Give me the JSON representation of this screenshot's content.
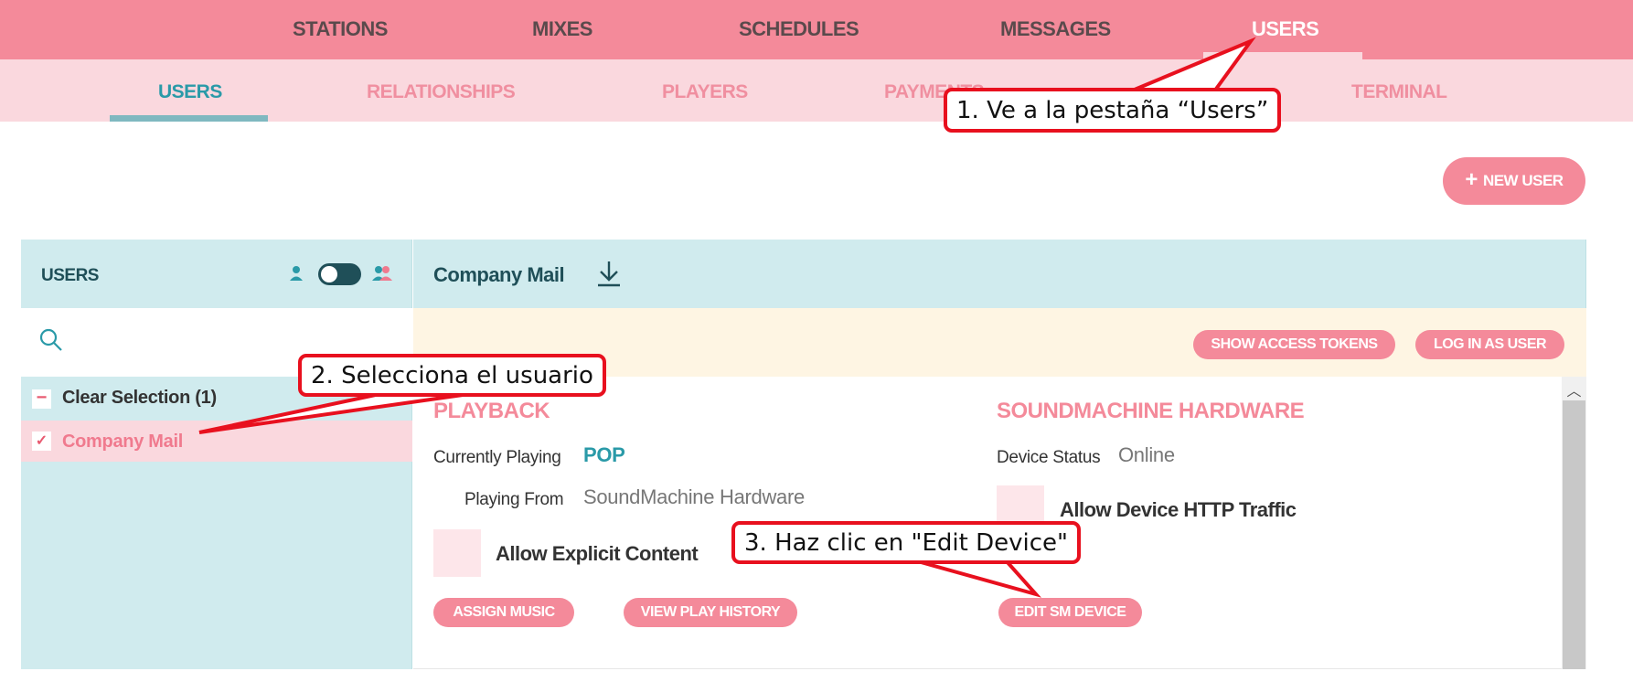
{
  "top_nav": {
    "tabs": [
      "STATIONS",
      "MIXES",
      "SCHEDULES",
      "MESSAGES",
      "USERS"
    ]
  },
  "sub_nav": {
    "tabs": [
      "USERS",
      "RELATIONSHIPS",
      "PLAYERS",
      "PAYMENTS",
      "TERMINAL"
    ]
  },
  "new_user_label": "NEW USER",
  "users_panel": {
    "title": "USERS",
    "search_placeholder": "",
    "clear_selection": "Clear Selection (1)",
    "users": [
      "Company Mail"
    ]
  },
  "detail": {
    "user_name": "Company Mail",
    "actions": {
      "show_tokens": "SHOW ACCESS TOKENS",
      "log_in": "LOG IN AS USER"
    },
    "playback": {
      "title": "PLAYBACK",
      "currently_playing_label": "Currently Playing",
      "currently_playing_value": "POP",
      "playing_from_label": "Playing From",
      "playing_from_value": "SoundMachine Hardware",
      "allow_explicit_label": "Allow Explicit Content",
      "assign_music": "ASSIGN MUSIC",
      "view_history": "VIEW PLAY HISTORY"
    },
    "hardware": {
      "title": "SOUNDMACHINE HARDWARE",
      "device_status_label": "Device Status",
      "device_status_value": "Online",
      "allow_http_label": "Allow Device HTTP Traffic",
      "edit_device": "EDIT SM DEVICE"
    }
  },
  "annotations": [
    "1. Ve a la pestaña “Users”",
    "2. Selecciona el usuario",
    "3. Haz clic en \"Edit Device\""
  ],
  "colors": {
    "brand_pink": "#f48a9a",
    "light_pink": "#fad8de",
    "teal": "#2a9aa8",
    "panel_teal": "#d0ebee",
    "callout_red": "#e8101e"
  }
}
